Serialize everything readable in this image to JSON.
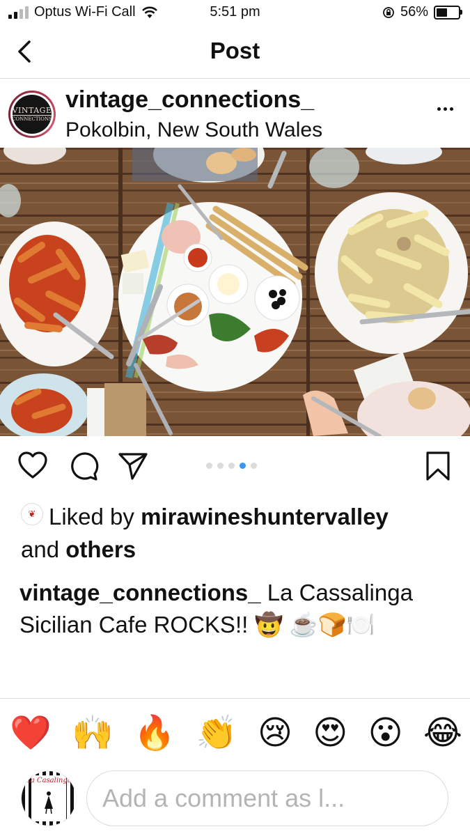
{
  "status_bar": {
    "carrier": "Optus Wi-Fi Call",
    "time": "5:51 pm",
    "battery": "56%",
    "battery_level": 0.56
  },
  "nav": {
    "title": "Post"
  },
  "post": {
    "username": "vintage_connections_",
    "location": "Pokolbin, New South Wales",
    "avatar_text_1": "VINTAGE",
    "avatar_text_2": "CONNECTIONS",
    "photo_description": "food-spread-on-wooden-table",
    "carousel": {
      "count": 5,
      "active_index": 3
    },
    "likes": {
      "prefix": "Liked by",
      "user": "mirawineshuntervalley",
      "joiner": "and",
      "others": "others"
    },
    "caption": {
      "username": "vintage_connections_",
      "text": "La Cassalinga Sicilian Cafe ROCKS!! 🤠 ☕🍞🍽️"
    }
  },
  "reactions": [
    "❤️",
    "🙌",
    "🔥",
    "👏",
    "😢",
    "😍",
    "😮",
    "😂"
  ],
  "comment": {
    "placeholder": "Add a comment as l...",
    "avatar_text": "La Casalinga"
  },
  "icons": {
    "back": "chevron-left-icon",
    "more": "ellipsis-icon",
    "like": "heart-icon",
    "comment": "comment-bubble-icon",
    "share": "paper-plane-icon",
    "save": "bookmark-icon"
  },
  "colors": {
    "accent": "#3897f0",
    "divider": "#dbdbdb",
    "placeholder": "#b4b4b4"
  }
}
